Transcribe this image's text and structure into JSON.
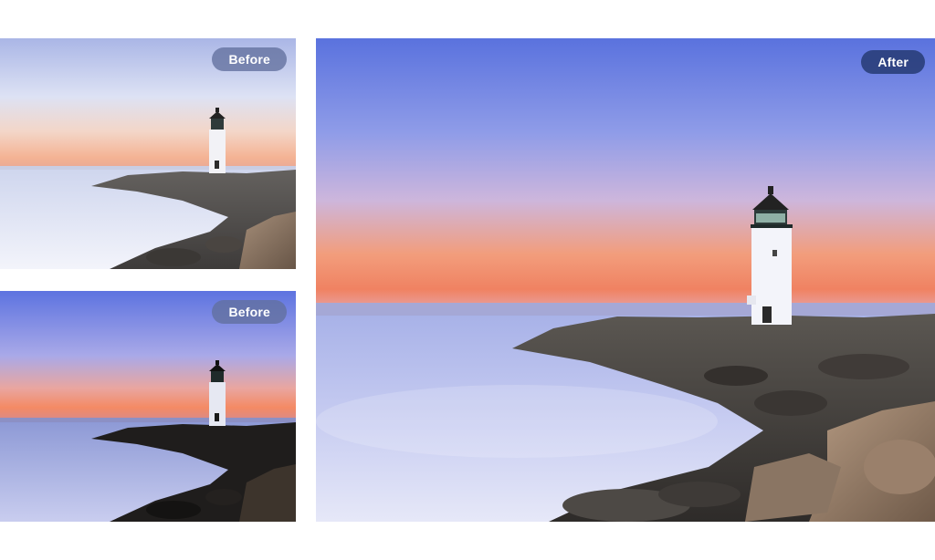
{
  "comparison": {
    "before_top": {
      "badge_label": "Before"
    },
    "before_bottom": {
      "badge_label": "Before"
    },
    "after": {
      "badge_label": "After"
    }
  },
  "colors": {
    "before_badge": "#62709e",
    "after_badge": "#283c76",
    "page_background": "#ffffff"
  }
}
